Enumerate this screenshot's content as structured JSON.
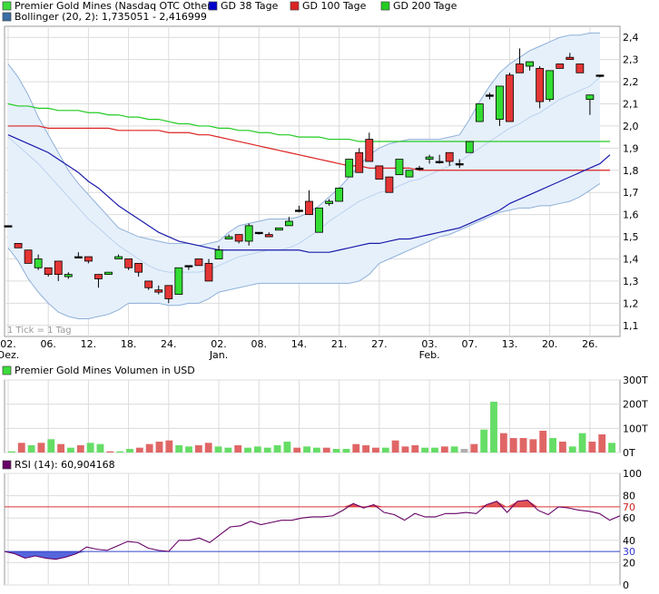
{
  "chart_data": [
    {
      "type": "candlestick",
      "legend": [
        {
          "label": "Premier Gold Mines (Nasdaq OTC Other)",
          "color": "#3cdc3c"
        },
        {
          "label": "GD 38 Tage",
          "color": "#0000cc"
        },
        {
          "label": "GD 100 Tage",
          "color": "#dd2222"
        },
        {
          "label": "GD 200 Tage",
          "color": "#22cc22"
        },
        {
          "label": "Bollinger (20, 2): 1,735051 - 2,416999",
          "color": "#3a6ea5"
        }
      ],
      "note": "1 Tick = 1 Tag",
      "y_axis": {
        "min": 1.05,
        "max": 2.45,
        "ticks": [
          "1,1",
          "1,2",
          "1,3",
          "1,4",
          "1,5",
          "1,6",
          "1,7",
          "1,8",
          "1,9",
          "2,0",
          "2,1",
          "2,2",
          "2,3",
          "2,4"
        ],
        "grid": true
      },
      "x_ticks": [
        {
          "label": "02.",
          "sub": "Dez.",
          "i": 0
        },
        {
          "label": "06.",
          "sub": "",
          "i": 4
        },
        {
          "label": "12.",
          "sub": "",
          "i": 8
        },
        {
          "label": "18.",
          "sub": "",
          "i": 12
        },
        {
          "label": "24.",
          "sub": "",
          "i": 16
        },
        {
          "label": "02.",
          "sub": "Jan.",
          "i": 21
        },
        {
          "label": "08.",
          "sub": "",
          "i": 25
        },
        {
          "label": "14.",
          "sub": "",
          "i": 29
        },
        {
          "label": "21.",
          "sub": "",
          "i": 33
        },
        {
          "label": "27.",
          "sub": "",
          "i": 37
        },
        {
          "label": "03.",
          "sub": "Feb.",
          "i": 42
        },
        {
          "label": "07.",
          "sub": "",
          "i": 46
        },
        {
          "label": "13.",
          "sub": "",
          "i": 50
        },
        {
          "label": "20.",
          "sub": "",
          "i": 54
        },
        {
          "label": "26.",
          "sub": "",
          "i": 58
        }
      ],
      "candles": [
        [
          1.55,
          1.55,
          1.55,
          1.55
        ],
        [
          1.47,
          1.47,
          1.45,
          1.45
        ],
        [
          1.44,
          1.44,
          1.38,
          1.38
        ],
        [
          1.36,
          1.42,
          1.35,
          1.4
        ],
        [
          1.36,
          1.36,
          1.32,
          1.33
        ],
        [
          1.39,
          1.39,
          1.3,
          1.33
        ],
        [
          1.32,
          1.34,
          1.31,
          1.33
        ],
        [
          1.41,
          1.43,
          1.41,
          1.41
        ],
        [
          1.41,
          1.41,
          1.38,
          1.39
        ],
        [
          1.33,
          1.33,
          1.27,
          1.31
        ],
        [
          1.33,
          1.33,
          1.34,
          1.34
        ],
        [
          1.4,
          1.42,
          1.4,
          1.41
        ],
        [
          1.4,
          1.4,
          1.35,
          1.36
        ],
        [
          1.38,
          1.38,
          1.32,
          1.34
        ],
        [
          1.3,
          1.3,
          1.26,
          1.27
        ],
        [
          1.26,
          1.28,
          1.24,
          1.25
        ],
        [
          1.28,
          1.28,
          1.2,
          1.22
        ],
        [
          1.24,
          1.36,
          1.24,
          1.36
        ],
        [
          1.37,
          1.37,
          1.35,
          1.37
        ],
        [
          1.4,
          1.4,
          1.37,
          1.37
        ],
        [
          1.38,
          1.4,
          1.3,
          1.3
        ],
        [
          1.4,
          1.46,
          1.4,
          1.44
        ],
        [
          1.49,
          1.51,
          1.49,
          1.5
        ],
        [
          1.51,
          1.51,
          1.47,
          1.48
        ],
        [
          1.48,
          1.56,
          1.46,
          1.55
        ],
        [
          1.52,
          1.52,
          1.51,
          1.52
        ],
        [
          1.51,
          1.52,
          1.5,
          1.5
        ],
        [
          1.53,
          1.54,
          1.53,
          1.54
        ],
        [
          1.55,
          1.59,
          1.55,
          1.57
        ],
        [
          1.62,
          1.64,
          1.61,
          1.62
        ],
        [
          1.66,
          1.71,
          1.6,
          1.6
        ],
        [
          1.52,
          1.63,
          1.52,
          1.63
        ],
        [
          1.65,
          1.67,
          1.64,
          1.66
        ],
        [
          1.66,
          1.72,
          1.66,
          1.72
        ],
        [
          1.77,
          1.85,
          1.77,
          1.85
        ],
        [
          1.88,
          1.9,
          1.79,
          1.79
        ],
        [
          1.94,
          1.97,
          1.84,
          1.84
        ],
        [
          1.82,
          1.82,
          1.76,
          1.76
        ],
        [
          1.77,
          1.77,
          1.7,
          1.7
        ],
        [
          1.78,
          1.85,
          1.78,
          1.85
        ],
        [
          1.77,
          1.8,
          1.77,
          1.8
        ],
        [
          1.81,
          1.82,
          1.8,
          1.81
        ],
        [
          1.85,
          1.87,
          1.83,
          1.86
        ],
        [
          1.84,
          1.87,
          1.83,
          1.84
        ],
        [
          1.88,
          1.88,
          1.82,
          1.84
        ],
        [
          1.83,
          1.85,
          1.81,
          1.83
        ],
        [
          1.88,
          1.93,
          1.88,
          1.93
        ],
        [
          2.02,
          2.1,
          2.02,
          2.1
        ],
        [
          2.14,
          2.15,
          2.12,
          2.14
        ],
        [
          2.03,
          2.18,
          2.0,
          2.18
        ],
        [
          2.23,
          2.24,
          2.02,
          2.02
        ],
        [
          2.28,
          2.35,
          2.24,
          2.24
        ],
        [
          2.27,
          2.29,
          2.25,
          2.29
        ],
        [
          2.26,
          2.27,
          2.08,
          2.11
        ],
        [
          2.12,
          2.25,
          2.11,
          2.25
        ],
        [
          2.28,
          2.28,
          2.26,
          2.26
        ],
        [
          2.31,
          2.33,
          2.3,
          2.3
        ],
        [
          2.28,
          2.28,
          2.24,
          2.24
        ],
        [
          2.12,
          2.14,
          2.05,
          2.14
        ],
        [
          2.23,
          2.23,
          2.22,
          2.23
        ]
      ],
      "gd38": [
        1.96,
        1.94,
        1.92,
        1.9,
        1.88,
        1.85,
        1.82,
        1.79,
        1.75,
        1.72,
        1.68,
        1.64,
        1.61,
        1.58,
        1.55,
        1.52,
        1.5,
        1.48,
        1.47,
        1.46,
        1.45,
        1.44,
        1.44,
        1.44,
        1.44,
        1.44,
        1.44,
        1.44,
        1.44,
        1.44,
        1.43,
        1.43,
        1.43,
        1.44,
        1.45,
        1.46,
        1.47,
        1.47,
        1.48,
        1.49,
        1.49,
        1.5,
        1.51,
        1.52,
        1.53,
        1.54,
        1.56,
        1.58,
        1.6,
        1.62,
        1.65,
        1.67,
        1.69,
        1.71,
        1.73,
        1.75,
        1.77,
        1.79,
        1.81,
        1.83,
        1.87
      ],
      "gd100": [
        2.0,
        2.0,
        2.0,
        2.0,
        1.99,
        1.99,
        1.99,
        1.99,
        1.99,
        1.99,
        1.99,
        1.98,
        1.98,
        1.98,
        1.98,
        1.98,
        1.97,
        1.97,
        1.97,
        1.96,
        1.96,
        1.95,
        1.94,
        1.93,
        1.92,
        1.91,
        1.9,
        1.89,
        1.88,
        1.87,
        1.86,
        1.85,
        1.84,
        1.83,
        1.82,
        1.82,
        1.81,
        1.81,
        1.81,
        1.81,
        1.81,
        1.8,
        1.8,
        1.8,
        1.8,
        1.8,
        1.8,
        1.8,
        1.8,
        1.8,
        1.8,
        1.8,
        1.8,
        1.8,
        1.8,
        1.8,
        1.8,
        1.8,
        1.8,
        1.8,
        1.8
      ],
      "gd200": [
        2.1,
        2.09,
        2.09,
        2.08,
        2.08,
        2.07,
        2.07,
        2.07,
        2.06,
        2.06,
        2.05,
        2.05,
        2.04,
        2.04,
        2.03,
        2.03,
        2.02,
        2.01,
        2.01,
        2.0,
        2.0,
        1.99,
        1.99,
        1.98,
        1.98,
        1.97,
        1.97,
        1.96,
        1.96,
        1.95,
        1.95,
        1.95,
        1.94,
        1.94,
        1.94,
        1.93,
        1.93,
        1.93,
        1.93,
        1.93,
        1.93,
        1.93,
        1.93,
        1.93,
        1.93,
        1.93,
        1.93,
        1.93,
        1.93,
        1.93,
        1.93,
        1.93,
        1.93,
        1.93,
        1.93,
        1.93,
        1.93,
        1.93,
        1.93,
        1.93,
        1.93
      ],
      "boll_upper": [
        2.28,
        2.22,
        2.14,
        2.04,
        1.96,
        1.88,
        1.8,
        1.74,
        1.69,
        1.64,
        1.59,
        1.54,
        1.52,
        1.5,
        1.49,
        1.48,
        1.47,
        1.47,
        1.47,
        1.46,
        1.47,
        1.48,
        1.52,
        1.55,
        1.56,
        1.57,
        1.58,
        1.58,
        1.58,
        1.59,
        1.61,
        1.64,
        1.68,
        1.72,
        1.77,
        1.82,
        1.87,
        1.9,
        1.92,
        1.93,
        1.94,
        1.94,
        1.94,
        1.94,
        1.95,
        1.96,
        2.03,
        2.11,
        2.18,
        2.24,
        2.28,
        2.31,
        2.34,
        2.36,
        2.38,
        2.4,
        2.41,
        2.41,
        2.42,
        2.42
      ],
      "boll_mid": [
        1.95,
        1.91,
        1.87,
        1.83,
        1.78,
        1.73,
        1.68,
        1.63,
        1.58,
        1.54,
        1.5,
        1.46,
        1.43,
        1.4,
        1.37,
        1.35,
        1.34,
        1.34,
        1.34,
        1.34,
        1.35,
        1.37,
        1.39,
        1.41,
        1.42,
        1.43,
        1.44,
        1.44,
        1.45,
        1.47,
        1.5,
        1.53,
        1.57,
        1.6,
        1.63,
        1.66,
        1.68,
        1.7,
        1.71,
        1.73,
        1.75,
        1.76,
        1.78,
        1.8,
        1.82,
        1.84,
        1.87,
        1.9,
        1.93,
        1.96,
        1.99,
        2.01,
        2.04,
        2.06,
        2.09,
        2.12,
        2.14,
        2.16,
        2.18,
        2.22
      ],
      "boll_lower": [
        1.45,
        1.39,
        1.31,
        1.25,
        1.2,
        1.16,
        1.14,
        1.13,
        1.13,
        1.14,
        1.15,
        1.17,
        1.2,
        1.2,
        1.2,
        1.2,
        1.19,
        1.19,
        1.2,
        1.2,
        1.22,
        1.25,
        1.26,
        1.27,
        1.28,
        1.29,
        1.29,
        1.29,
        1.29,
        1.29,
        1.29,
        1.29,
        1.29,
        1.29,
        1.29,
        1.3,
        1.33,
        1.38,
        1.4,
        1.42,
        1.44,
        1.46,
        1.48,
        1.5,
        1.51,
        1.53,
        1.55,
        1.57,
        1.59,
        1.61,
        1.62,
        1.63,
        1.63,
        1.64,
        1.64,
        1.65,
        1.66,
        1.68,
        1.71,
        1.74
      ]
    },
    {
      "type": "bar",
      "legend": [
        {
          "label": "Premier Gold Mines Volumen in USD",
          "color": "#3cdc3c"
        }
      ],
      "y_axis": {
        "min": 0,
        "max": 300,
        "ticks": [
          "0T",
          "100T",
          "200T",
          "300T"
        ],
        "grid": true
      },
      "volumes": [
        [
          5,
          "g"
        ],
        [
          40,
          "r"
        ],
        [
          30,
          "g"
        ],
        [
          40,
          "r"
        ],
        [
          55,
          "g"
        ],
        [
          35,
          "r"
        ],
        [
          20,
          "g"
        ],
        [
          30,
          "r"
        ],
        [
          40,
          "g"
        ],
        [
          35,
          "g"
        ],
        [
          5,
          "r"
        ],
        [
          5,
          "g"
        ],
        [
          15,
          "g"
        ],
        [
          20,
          "r"
        ],
        [
          35,
          "r"
        ],
        [
          45,
          "r"
        ],
        [
          50,
          "r"
        ],
        [
          30,
          "g"
        ],
        [
          25,
          "g"
        ],
        [
          30,
          "r"
        ],
        [
          40,
          "r"
        ],
        [
          25,
          "g"
        ],
        [
          20,
          "g"
        ],
        [
          30,
          "r"
        ],
        [
          20,
          "g"
        ],
        [
          25,
          "g"
        ],
        [
          20,
          "g"
        ],
        [
          30,
          "g"
        ],
        [
          45,
          "g"
        ],
        [
          20,
          "r"
        ],
        [
          25,
          "g"
        ],
        [
          20,
          "g"
        ],
        [
          20,
          "r"
        ],
        [
          15,
          "g"
        ],
        [
          15,
          "g"
        ],
        [
          35,
          "r"
        ],
        [
          30,
          "r"
        ],
        [
          20,
          "r"
        ],
        [
          20,
          "g"
        ],
        [
          50,
          "r"
        ],
        [
          25,
          "r"
        ],
        [
          30,
          "r"
        ],
        [
          20,
          "g"
        ],
        [
          20,
          "g"
        ],
        [
          25,
          "r"
        ],
        [
          25,
          "g"
        ],
        [
          15,
          "x"
        ],
        [
          35,
          "r"
        ],
        [
          95,
          "g"
        ],
        [
          210,
          "g"
        ],
        [
          80,
          "r"
        ],
        [
          60,
          "r"
        ],
        [
          60,
          "r"
        ],
        [
          55,
          "r"
        ],
        [
          90,
          "r"
        ],
        [
          60,
          "g"
        ],
        [
          45,
          "r"
        ],
        [
          25,
          "g"
        ],
        [
          80,
          "g"
        ],
        [
          45,
          "r"
        ],
        [
          75,
          "r"
        ],
        [
          40,
          "g"
        ]
      ]
    },
    {
      "type": "line",
      "legend": [
        {
          "label": "RSI (14): 60,904168",
          "color": "#660066"
        }
      ],
      "y_axis": {
        "min": 0,
        "max": 100,
        "ticks": [
          "0",
          "20",
          "30",
          "40",
          "60",
          "70",
          "80",
          "100"
        ],
        "grid": true
      },
      "levels": {
        "upper": 70,
        "lower": 30
      },
      "rsi": [
        30,
        28,
        24,
        26,
        24,
        23,
        25,
        28,
        34,
        32,
        31,
        35,
        39,
        38,
        33,
        31,
        30,
        40,
        40,
        42,
        38,
        45,
        52,
        53,
        57,
        54,
        56,
        58,
        58,
        60,
        61,
        61,
        62,
        67,
        73,
        69,
        72,
        65,
        63,
        58,
        64,
        61,
        61,
        64,
        64,
        65,
        64,
        72,
        75,
        65,
        75,
        76,
        67,
        63,
        70,
        69,
        67,
        66,
        64,
        58,
        62
      ]
    }
  ]
}
